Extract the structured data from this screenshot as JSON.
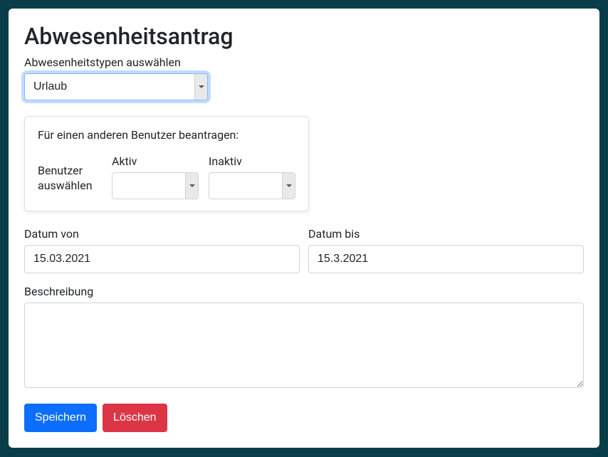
{
  "title": "Abwesenheitsantrag",
  "typeSelect": {
    "label": "Abwesenheitstypen auswählen",
    "value": "Urlaub"
  },
  "otherUser": {
    "heading": "Für einen anderen Benutzer beantragen:",
    "selectUserLabel": "Benutzer auswählen",
    "activeLabel": "Aktiv",
    "inactiveLabel": "Inaktiv",
    "activeValue": "",
    "inactiveValue": ""
  },
  "dateFrom": {
    "label": "Datum von",
    "value": "15.03.2021"
  },
  "dateTo": {
    "label": "Datum bis",
    "value": "15.3.2021"
  },
  "description": {
    "label": "Beschreibung",
    "value": ""
  },
  "buttons": {
    "save": "Speichern",
    "delete": "Löschen"
  }
}
